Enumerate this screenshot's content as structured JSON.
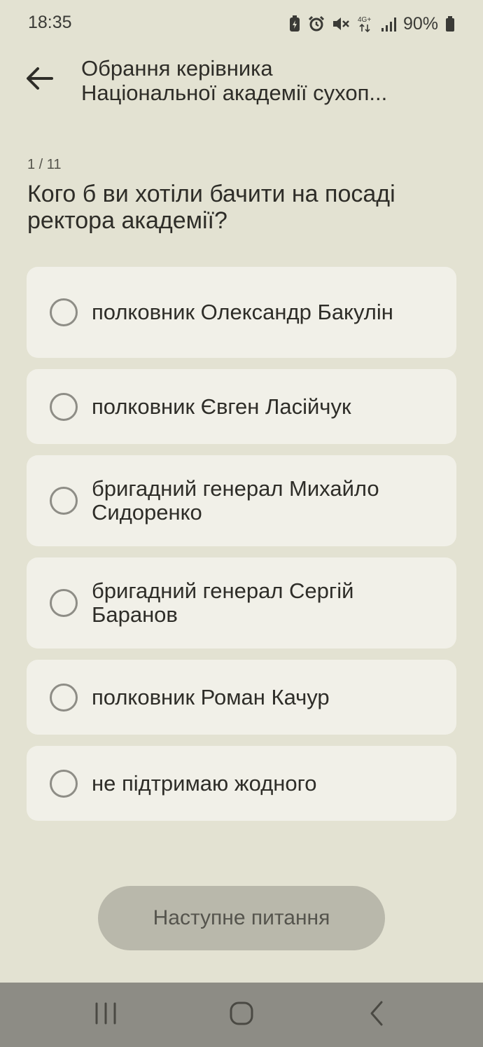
{
  "status_bar": {
    "time": "18:35",
    "network": "4G+",
    "battery": "90%"
  },
  "header": {
    "title_line1": "Обрання керівника",
    "title_line2": "Національної академії сухоп..."
  },
  "quiz": {
    "progress": "1 / 11",
    "question": "Кого б ви хотіли бачити на посаді ректора академії?",
    "options": [
      {
        "label": "полковник Олександр Бакулін"
      },
      {
        "label": "полковник Євген Ласійчук"
      },
      {
        "label": "бригадний генерал Михайло Сидоренко"
      },
      {
        "label": "бригадний генерал Сергій Баранов"
      },
      {
        "label": "полковник Роман Качур"
      },
      {
        "label": "не підтримаю жодного"
      }
    ],
    "next_label": "Наступне питання"
  },
  "colors": {
    "background": "#e3e2d2",
    "card": "#f1f0e8",
    "button_disabled": "#b9b8ab",
    "nav_bar": "#8d8c85"
  },
  "icons": {
    "back": "arrow-left-icon",
    "radio": "radio-unchecked-icon",
    "nav_recents": "recents-icon",
    "nav_home": "home-icon",
    "nav_back": "chevron-left-icon"
  }
}
